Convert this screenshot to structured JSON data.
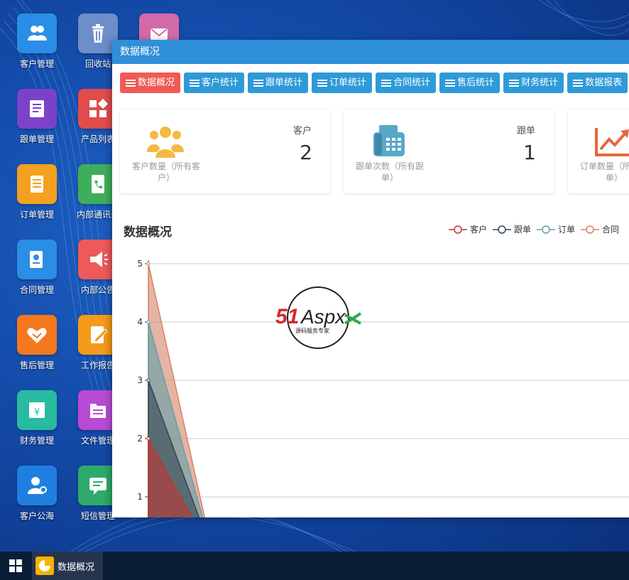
{
  "desktop": {
    "icons": [
      {
        "label": "客户管理",
        "name": "customers",
        "color": "#2a8ee6"
      },
      {
        "label": "回收站",
        "name": "recycle-bin",
        "color": "#6c8ec9"
      },
      {
        "label": "",
        "name": "mail",
        "color": "#d36aa8"
      },
      {
        "label": "跟单管理",
        "name": "follow-up",
        "color": "#7b42c9"
      },
      {
        "label": "产品列表",
        "name": "products",
        "color": "#e04c4c"
      },
      {
        "label": "订单管理",
        "name": "orders",
        "color": "#f4a11f"
      },
      {
        "label": "内部通讯录",
        "name": "contacts",
        "color": "#3fae5a"
      },
      {
        "label": "合同管理",
        "name": "contracts",
        "color": "#2a8ee6"
      },
      {
        "label": "内部公告",
        "name": "announcements",
        "color": "#ee5a5a"
      },
      {
        "label": "售后管理",
        "name": "after-sales",
        "color": "#f47820"
      },
      {
        "label": "工作报告",
        "name": "work-report",
        "color": "#f59a1a"
      },
      {
        "label": "财务管理",
        "name": "finance",
        "color": "#28bba0"
      },
      {
        "label": "文件管理",
        "name": "files",
        "color": "#b84ad6"
      },
      {
        "label": "客户公海",
        "name": "customer-pool",
        "color": "#1e7fe0"
      },
      {
        "label": "短信管理",
        "name": "sms",
        "color": "#2eaa6a"
      }
    ]
  },
  "window": {
    "title": "数据概况",
    "tabs": [
      {
        "label": "数据概况",
        "active": true
      },
      {
        "label": "客户统计",
        "active": false
      },
      {
        "label": "跟单统计",
        "active": false
      },
      {
        "label": "订单统计",
        "active": false
      },
      {
        "label": "合同统计",
        "active": false
      },
      {
        "label": "售后统计",
        "active": false
      },
      {
        "label": "财务统计",
        "active": false
      },
      {
        "label": "数据报表",
        "active": false
      }
    ],
    "cards": [
      {
        "name": "客户",
        "value": "2",
        "desc": "客户数量（所有客户）",
        "icon": "users-icon",
        "color": "#f4b942"
      },
      {
        "name": "跟单",
        "value": "1",
        "desc": "跟单次数（所有跟单）",
        "icon": "fax-icon",
        "color": "#57a9c9"
      },
      {
        "name": "",
        "value": "",
        "desc": "订单数量（所有订单）",
        "icon": "trend-icon",
        "color": "#e8663c"
      }
    ],
    "chart_title": "数据概况"
  },
  "watermark": {
    "text": "51Aspx",
    "subtext": "源码服务专家"
  },
  "chart_data": {
    "type": "area",
    "title": "数据概况",
    "ylim": [
      0,
      5
    ],
    "yticks": [
      "1",
      "2",
      "3",
      "4",
      "5"
    ],
    "grid": true,
    "legend_position": "top-right",
    "series": [
      {
        "name": "客户",
        "color": "#c23531",
        "values": [
          2,
          0
        ]
      },
      {
        "name": "跟单",
        "color": "#2f4554",
        "values": [
          3,
          0
        ]
      },
      {
        "name": "订单",
        "color": "#61a0a8",
        "values": [
          4,
          0
        ]
      },
      {
        "name": "合同",
        "color": "#d48265",
        "values": [
          5,
          0
        ]
      }
    ]
  },
  "taskbar": {
    "start_icon": "windows-icon",
    "task_label": "数据概况"
  }
}
